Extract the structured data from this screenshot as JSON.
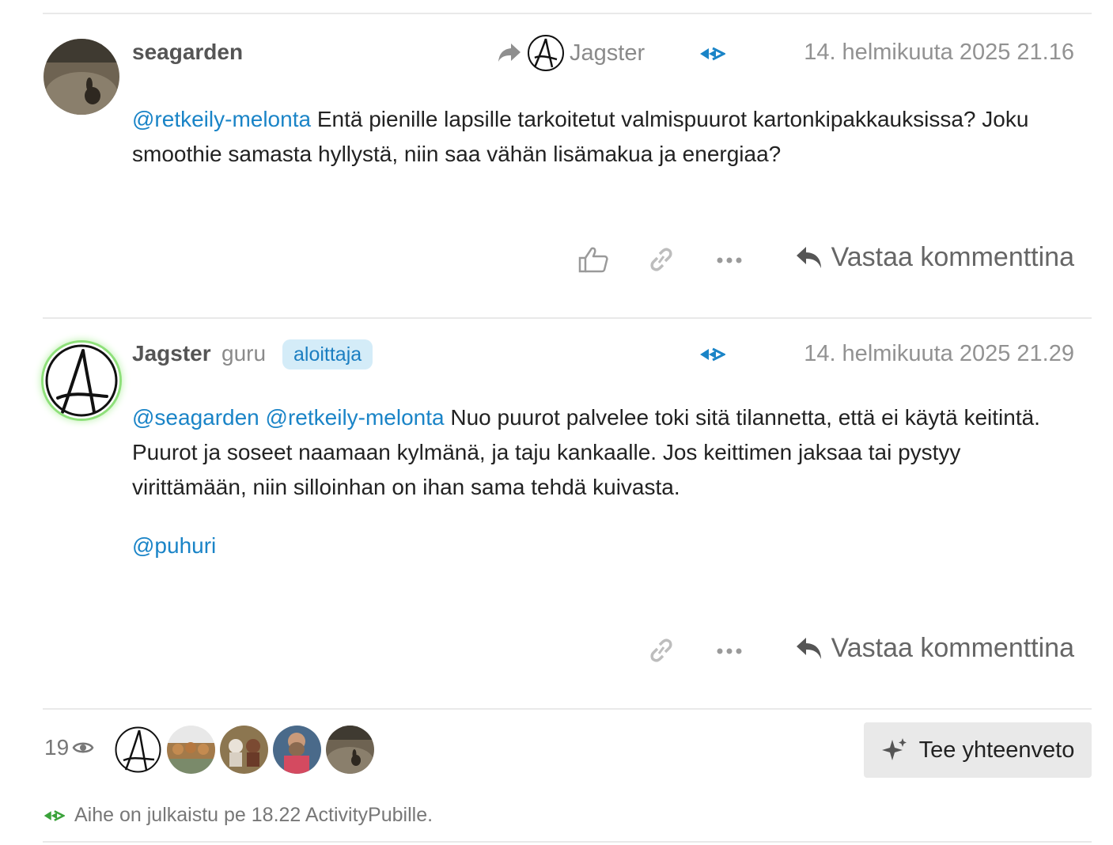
{
  "posts": [
    {
      "username": "seagarden",
      "reply_to": {
        "username": "Jagster",
        "avatar_icon": "anarchy-a-avatar"
      },
      "timestamp": "14. helmikuuta 2025 21.16",
      "mentions": [
        "@retkeily-melonta"
      ],
      "text": "Entä pienille lapsille tarkoitetut valmispuurot kartonkipakkauksissa? Joku smoothie samasta hyllystä, niin saa vähän lisämakua ja energiaa?",
      "actions": {
        "like_icon": "thumbs-up-icon",
        "link_icon": "link-icon",
        "more_icon": "ellipsis-icon",
        "reply_label": "Vastaa kommenttina"
      }
    },
    {
      "username": "Jagster",
      "user_title": "guru",
      "badge": "aloittaja",
      "timestamp": "14. helmikuuta 2025 21.29",
      "mentions": [
        "@seagarden",
        "@retkeily-melonta"
      ],
      "text": "Nuo puurot palvelee toki sitä tilannetta, että ei käytä keitintä. Puurot ja soseet naamaan kylmänä, ja taju kankaalle. Jos keittimen jaksaa tai pystyy virittämään, niin silloinhan on ihan sama tehdä kuivasta.",
      "extra_mention": "@puhuri",
      "actions": {
        "link_icon": "link-icon",
        "more_icon": "ellipsis-icon",
        "reply_label": "Vastaa kommenttina"
      }
    }
  ],
  "footer": {
    "views": "19",
    "views_icon": "eye-icon",
    "summary_label": "Tee yhteenveto",
    "published_text": "Aihe on julkaistu pe 18.22 ActivityPubille."
  },
  "colors": {
    "mention": "#1a84c7",
    "activitypub_blue": "#1a84c7",
    "activitypub_green": "#3aa23a",
    "badge_bg": "#d4ecf8"
  }
}
